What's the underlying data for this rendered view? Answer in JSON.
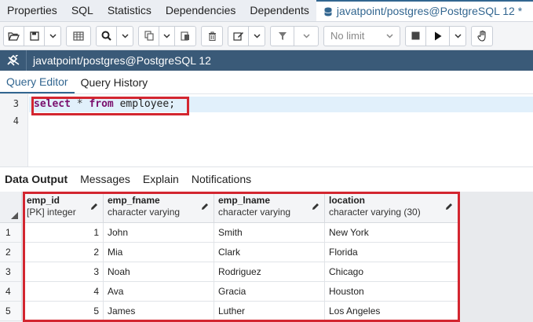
{
  "top_tabs": [
    {
      "label": "Properties"
    },
    {
      "label": "SQL"
    },
    {
      "label": "Statistics"
    },
    {
      "label": "Dependencies"
    },
    {
      "label": "Dependents"
    },
    {
      "label": "javatpoint/postgres@PostgreSQL 12 *"
    }
  ],
  "toolbar": {
    "limit_select": "No limit",
    "icons": [
      "folder-open-icon",
      "save-icon",
      "chevron-down-icon",
      "grid-icon",
      "search-icon",
      "copy-icon",
      "paste-icon",
      "delete-icon",
      "edit-icon",
      "filter-icon",
      "stop-icon",
      "play-icon",
      "hand-icon"
    ]
  },
  "connection": {
    "label": "javatpoint/postgres@PostgreSQL 12"
  },
  "query_tabs": [
    {
      "label": "Query Editor"
    },
    {
      "label": "Query History"
    }
  ],
  "editor": {
    "lines": [
      {
        "number": "3",
        "keyword1": "select",
        "operator": " * ",
        "keyword2": "from",
        "rest": " employee;"
      },
      {
        "number": "4"
      }
    ]
  },
  "result_tabs": [
    {
      "label": "Data Output"
    },
    {
      "label": "Messages"
    },
    {
      "label": "Explain"
    },
    {
      "label": "Notifications"
    }
  ],
  "grid": {
    "columns": [
      {
        "name": "emp_id",
        "type": "[PK] integer"
      },
      {
        "name": "emp_fname",
        "type": "character varying"
      },
      {
        "name": "emp_lname",
        "type": "character varying"
      },
      {
        "name": "location",
        "type": "character varying (30)"
      }
    ],
    "rows": [
      {
        "n": "1",
        "emp_id": "1",
        "emp_fname": "John",
        "emp_lname": "Smith",
        "location": "New York"
      },
      {
        "n": "2",
        "emp_id": "2",
        "emp_fname": "Mia",
        "emp_lname": "Clark",
        "location": "Florida"
      },
      {
        "n": "3",
        "emp_id": "3",
        "emp_fname": "Noah",
        "emp_lname": "Rodriguez",
        "location": "Chicago"
      },
      {
        "n": "4",
        "emp_id": "4",
        "emp_fname": "Ava",
        "emp_lname": "Gracia",
        "location": "Houston"
      },
      {
        "n": "5",
        "emp_id": "5",
        "emp_fname": "James",
        "emp_lname": "Luther",
        "location": "Los Angeles"
      }
    ]
  },
  "colors": {
    "accent": "#326690",
    "highlight": "#d32630",
    "connection_bar": "#3a5a78",
    "keyword": "#7a0f6d"
  }
}
